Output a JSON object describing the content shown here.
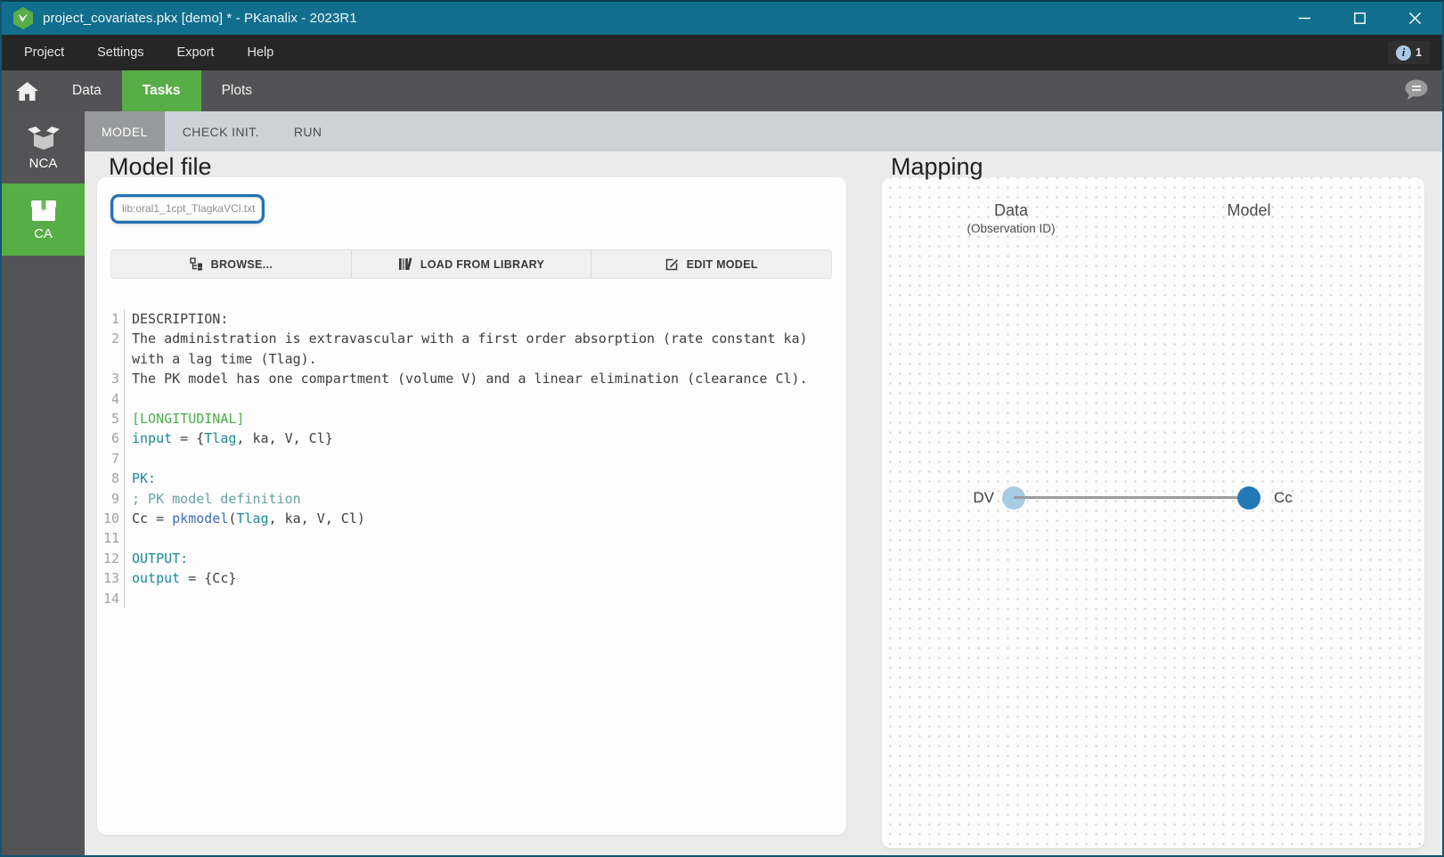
{
  "window": {
    "title": "project_covariates.pkx [demo] * - PKanalix - 2023R1"
  },
  "menu": {
    "items": [
      "Project",
      "Settings",
      "Export",
      "Help"
    ],
    "notification_count": "1"
  },
  "tabs": [
    {
      "label": "Data",
      "active": false
    },
    {
      "label": "Tasks",
      "active": true
    },
    {
      "label": "Plots",
      "active": false
    }
  ],
  "sidebar": {
    "items": [
      {
        "label": "NCA",
        "active": false
      },
      {
        "label": "CA",
        "active": true
      }
    ]
  },
  "task_tabs": [
    {
      "label": "MODEL",
      "active": true
    },
    {
      "label": "CHECK INIT.",
      "active": false
    },
    {
      "label": "RUN",
      "active": false
    }
  ],
  "model_file": {
    "heading": "Model file",
    "file_input": "lib:oral1_1cpt_TlagkaVCl.txt",
    "buttons": [
      {
        "label": "BROWSE...",
        "icon": "folder-tree-icon"
      },
      {
        "label": "LOAD FROM LIBRARY",
        "icon": "library-books-icon"
      },
      {
        "label": "EDIT MODEL",
        "icon": "edit-pencil-icon"
      }
    ],
    "code": {
      "lines": [
        {
          "num": 1,
          "segments": [
            {
              "t": "DESCRIPTION:",
              "c": "p"
            }
          ]
        },
        {
          "num": 2,
          "segments": [
            {
              "t": "The administration is extravascular with a first order absorption (rate constant ka) with a lag time (Tlag).",
              "c": "p"
            }
          ]
        },
        {
          "num": 3,
          "segments": [
            {
              "t": "The PK model has one compartment (volume V) and a linear elimination (clearance Cl).",
              "c": "p"
            }
          ]
        },
        {
          "num": 4,
          "segments": []
        },
        {
          "num": 5,
          "segments": [
            {
              "t": "[LONGITUDINAL]",
              "c": "g"
            }
          ]
        },
        {
          "num": 6,
          "segments": [
            {
              "t": "input",
              "c": "k"
            },
            {
              "t": " = {",
              "c": "p"
            },
            {
              "t": "Tlag",
              "c": "k"
            },
            {
              "t": ", ka, V, Cl}",
              "c": "p"
            }
          ]
        },
        {
          "num": 7,
          "segments": []
        },
        {
          "num": 8,
          "segments": [
            {
              "t": "PK:",
              "c": "k"
            }
          ]
        },
        {
          "num": 9,
          "segments": [
            {
              "t": "; PK model definition",
              "c": "c"
            }
          ]
        },
        {
          "num": 10,
          "segments": [
            {
              "t": "Cc = ",
              "c": "p"
            },
            {
              "t": "pkmodel",
              "c": "b"
            },
            {
              "t": "(",
              "c": "p"
            },
            {
              "t": "Tlag",
              "c": "k"
            },
            {
              "t": ", ka, V, Cl)",
              "c": "p"
            }
          ]
        },
        {
          "num": 11,
          "segments": []
        },
        {
          "num": 12,
          "segments": [
            {
              "t": "OUTPUT:",
              "c": "k"
            }
          ]
        },
        {
          "num": 13,
          "segments": [
            {
              "t": "output",
              "c": "k"
            },
            {
              "t": " = {Cc}",
              "c": "p"
            }
          ]
        },
        {
          "num": 14,
          "segments": []
        }
      ]
    }
  },
  "mapping": {
    "heading": "Mapping",
    "col_data": "Data",
    "col_data_sub": "(Observation ID)",
    "col_model": "Model",
    "rows": [
      {
        "data_label": "DV",
        "model_label": "Cc"
      }
    ]
  },
  "colors": {
    "titlebar_teal": "#116f8d",
    "accent_green": "#57ad46",
    "focus_blue": "#2272b5",
    "map_handle_light": "#a7cbe2",
    "map_handle_dark": "#2478b5",
    "code_keyword_teal": "#1b8a96",
    "code_section_green": "#4cae4c",
    "code_function_blue": "#3b6fb5",
    "code_comment": "#68a0a6"
  }
}
